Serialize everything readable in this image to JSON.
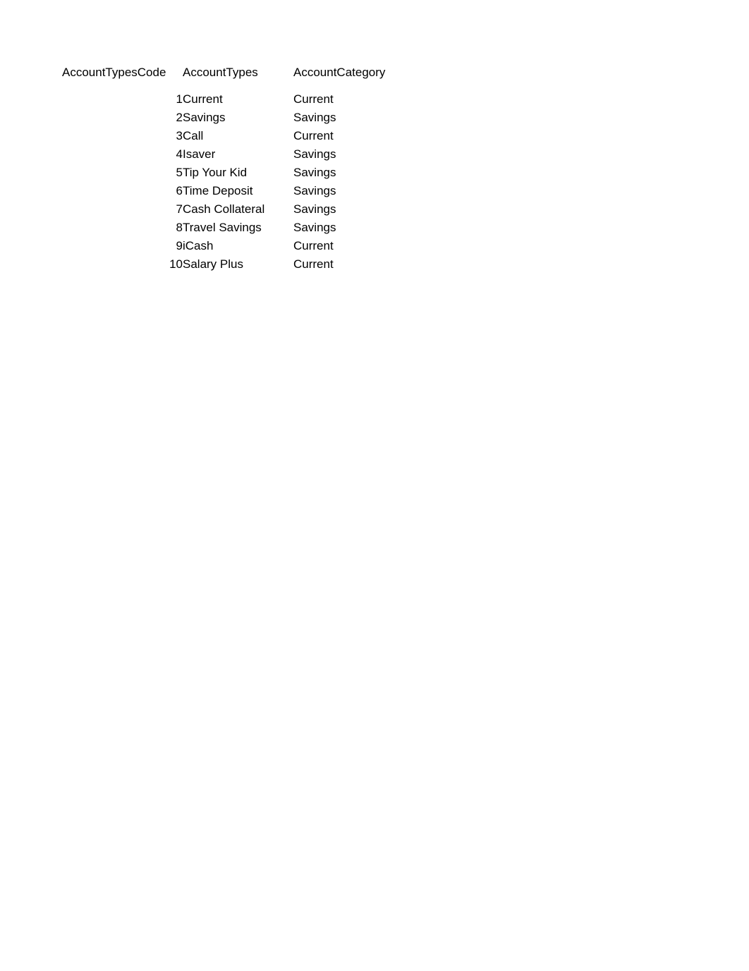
{
  "document": {
    "title": "AccountTypes",
    "background_color": "#ffffff",
    "text_color": "#000000"
  },
  "table": {
    "name": "account-types-table",
    "columns": [
      {
        "key": "code",
        "label": "AccountTypesCode",
        "align": "right"
      },
      {
        "key": "type",
        "label": "AccountTypes",
        "align": "left"
      },
      {
        "key": "category",
        "label": "AccountCategory",
        "align": "left"
      }
    ],
    "rows": [
      {
        "code": "1",
        "type": "Current",
        "category": "Current"
      },
      {
        "code": "2",
        "type": "Savings",
        "category": "Savings"
      },
      {
        "code": "3",
        "type": "Call",
        "category": "Current"
      },
      {
        "code": "4",
        "type": "Isaver",
        "category": "Savings"
      },
      {
        "code": "5",
        "type": "Tip Your Kid",
        "category": "Savings"
      },
      {
        "code": "6",
        "type": "Time Deposit",
        "category": "Savings"
      },
      {
        "code": "7",
        "type": "Cash Collateral",
        "category": "Savings"
      },
      {
        "code": "8",
        "type": "Travel Savings",
        "category": "Savings"
      },
      {
        "code": "9",
        "type": "iCash",
        "category": "Current"
      },
      {
        "code": "10",
        "type": "Salary Plus",
        "category": "Current"
      }
    ]
  },
  "chart_data": {
    "type": "table",
    "title": "AccountTypes",
    "columns": [
      "AccountTypesCode",
      "AccountTypes",
      "AccountCategory"
    ],
    "rows": [
      [
        "1",
        "Current",
        "Current"
      ],
      [
        "2",
        "Savings",
        "Savings"
      ],
      [
        "3",
        "Call",
        "Current"
      ],
      [
        "4",
        "Isaver",
        "Savings"
      ],
      [
        "5",
        "Tip Your Kid",
        "Savings"
      ],
      [
        "6",
        "Time Deposit",
        "Savings"
      ],
      [
        "7",
        "Cash Collateral",
        "Savings"
      ],
      [
        "8",
        "Travel Savings",
        "Savings"
      ],
      [
        "9",
        "iCash",
        "Current"
      ],
      [
        "10",
        "Salary Plus",
        "Current"
      ]
    ]
  }
}
